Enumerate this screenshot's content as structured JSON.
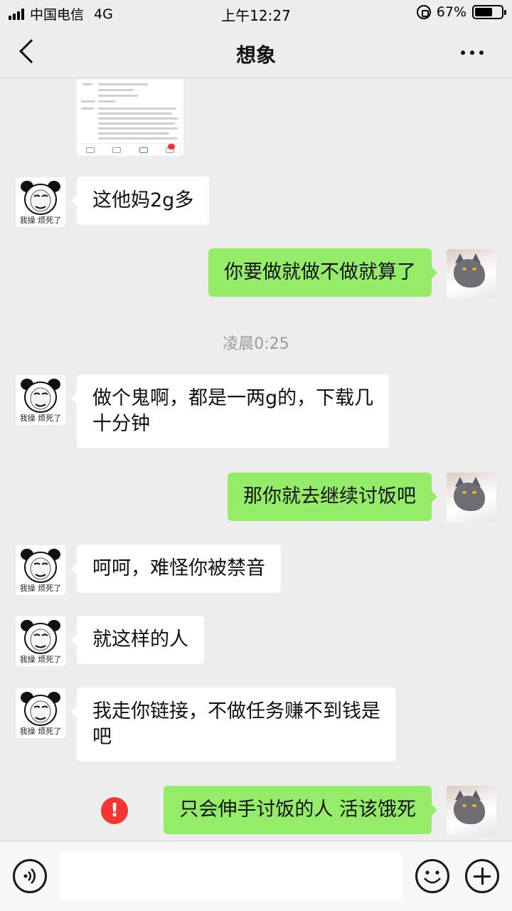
{
  "status_bar": {
    "carrier": "中国电信",
    "network": "4G",
    "time": "上午12:27",
    "battery_percent": "67%",
    "battery_level": 0.67
  },
  "header": {
    "title": "想象"
  },
  "preview_card": {
    "icon": "app-store-screenshot"
  },
  "messages": [
    {
      "side": "in",
      "text": "这他妈2g多",
      "avatar_caption": "我操 烦死了"
    },
    {
      "side": "out",
      "text": "你要做就做不做就算了"
    },
    {
      "side": "in",
      "text": "做个鬼啊，都是一两g的，下载几\n十分钟",
      "avatar_caption": "我操 烦死了"
    },
    {
      "side": "out",
      "text": "那你就去继续讨饭吧"
    },
    {
      "side": "in",
      "text": "呵呵，难怪你被禁音",
      "avatar_caption": "我操 烦死了"
    },
    {
      "side": "in",
      "text": "就这样的人",
      "avatar_caption": "我操 烦死了"
    },
    {
      "side": "in",
      "text": "我走你链接，不做任务赚不到钱是\n吧",
      "avatar_caption": "我操 烦死了"
    },
    {
      "side": "out",
      "text": "只会伸手讨饭的人 活该饿死",
      "failed": true
    }
  ],
  "timestamp": "凌晨0:25",
  "error_mark": "!",
  "input_bar": {
    "value": "",
    "icons": [
      "voice-icon",
      "emoji-icon",
      "plus-icon"
    ]
  },
  "colors": {
    "background": "#ededed",
    "outgoing_bubble": "#95ec69",
    "incoming_bubble": "#ffffff",
    "error": "#f43530"
  }
}
